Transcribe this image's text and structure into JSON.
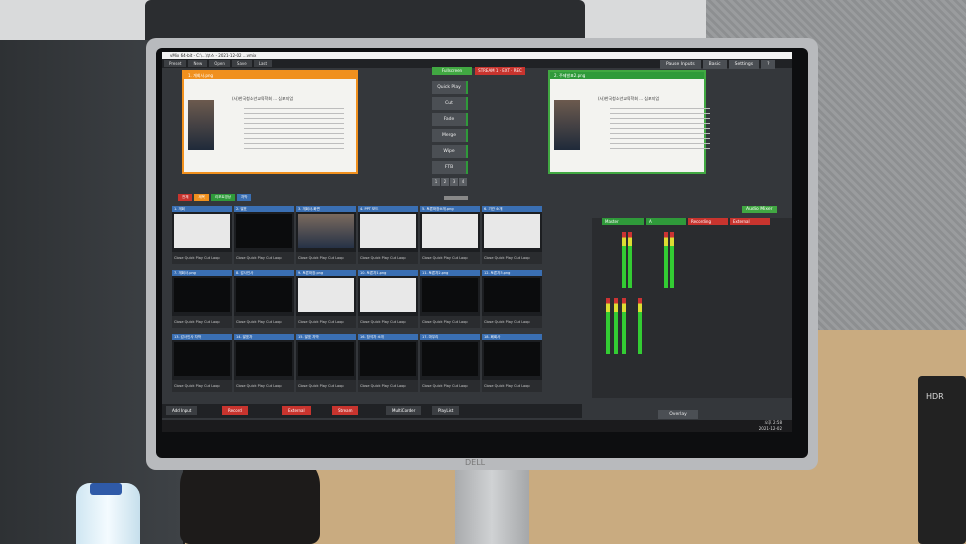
{
  "window": {
    "title": "vMix 64-bit - C:\\...\\부스 - 2021-12-02 ...vmix"
  },
  "menu": {
    "items": [
      "Preset",
      "New",
      "Open",
      "Save",
      "Last"
    ]
  },
  "top_right": {
    "pause_inputs": "Pause Inputs",
    "basic": "Basic",
    "settings": "Settings",
    "help": "?"
  },
  "transition": {
    "follow": "Fullscreen",
    "stream_rec": "STREAM 1 · EXT · REC",
    "buttons": [
      "Quick Play",
      "Cut",
      "Fade",
      "Merge",
      "Wipe",
      "FTB"
    ],
    "numbers": [
      "1",
      "2",
      "3",
      "4"
    ]
  },
  "preview": {
    "header": "1. 개회사.png",
    "slide_title": "(사)한국청소년교육학회 ... 심포지엄",
    "logo": "KNPE"
  },
  "output": {
    "header": "2. 주제발표2.png",
    "slide_title": "(사)한국청소년교육학회 ... 심포지엄",
    "logo": "KNPE"
  },
  "tags": [
    {
      "label": "전체",
      "color": "#c8342e"
    },
    {
      "label": "제목",
      "color": "#f0901e"
    },
    {
      "label": "리포트영상",
      "color": "#2f9a3a"
    },
    {
      "label": "자막",
      "color": "#3a6fb3"
    }
  ],
  "inputs": [
    {
      "num": "1",
      "name": "1. 개회",
      "thumb": "slide"
    },
    {
      "num": "2",
      "name": "2. 발표",
      "thumb": "dark"
    },
    {
      "num": "3",
      "name": "3. 개회사-화면",
      "thumb": "person"
    },
    {
      "num": "4",
      "name": "4. PPT 모드",
      "thumb": "slide"
    },
    {
      "num": "5",
      "name": "5. 토론좌장소개.png",
      "thumb": "slide"
    },
    {
      "num": "6",
      "name": "6. 기관 소개",
      "thumb": "slide"
    },
    {
      "num": "7",
      "name": "7. 개회사.png",
      "thumb": "dark"
    },
    {
      "num": "8",
      "name": "8. 감사인사",
      "thumb": "dark"
    },
    {
      "num": "9",
      "name": "9. 토론좌장.png",
      "thumb": "slide"
    },
    {
      "num": "10",
      "name": "10. 토론자1.png",
      "thumb": "slide"
    },
    {
      "num": "11",
      "name": "11. 토론자2.png",
      "thumb": "dark"
    },
    {
      "num": "12",
      "name": "12. 토론자3.png",
      "thumb": "dark"
    },
    {
      "num": "13",
      "name": "13. 감사인사 자막",
      "thumb": "dark"
    },
    {
      "num": "14",
      "name": "14. 발표자",
      "thumb": "dark"
    },
    {
      "num": "15",
      "name": "15. 발표 자막",
      "thumb": "dark"
    },
    {
      "num": "16",
      "name": "16. 참석자 소개",
      "thumb": "dark"
    },
    {
      "num": "17",
      "name": "17. 마무리",
      "thumb": "dark"
    },
    {
      "num": "18",
      "name": "18. 폐회사",
      "thumb": "dark"
    }
  ],
  "tile_controls": "Close  Quick Play  Cut  Loop",
  "audio": {
    "title": "Audio Mixer",
    "channels": [
      "Master",
      "A",
      "Recording",
      "External"
    ]
  },
  "statusbar": {
    "add_input": "Add Input",
    "record": "Record",
    "external": "External",
    "stream": "Stream",
    "multicorder": "MultiCorder",
    "playlist": "PlayList",
    "overlay": "Overlay"
  },
  "clock": {
    "time": "오후 2:58",
    "date": "2021-12-02"
  },
  "brand": "DELL",
  "camera_label": "HDR"
}
